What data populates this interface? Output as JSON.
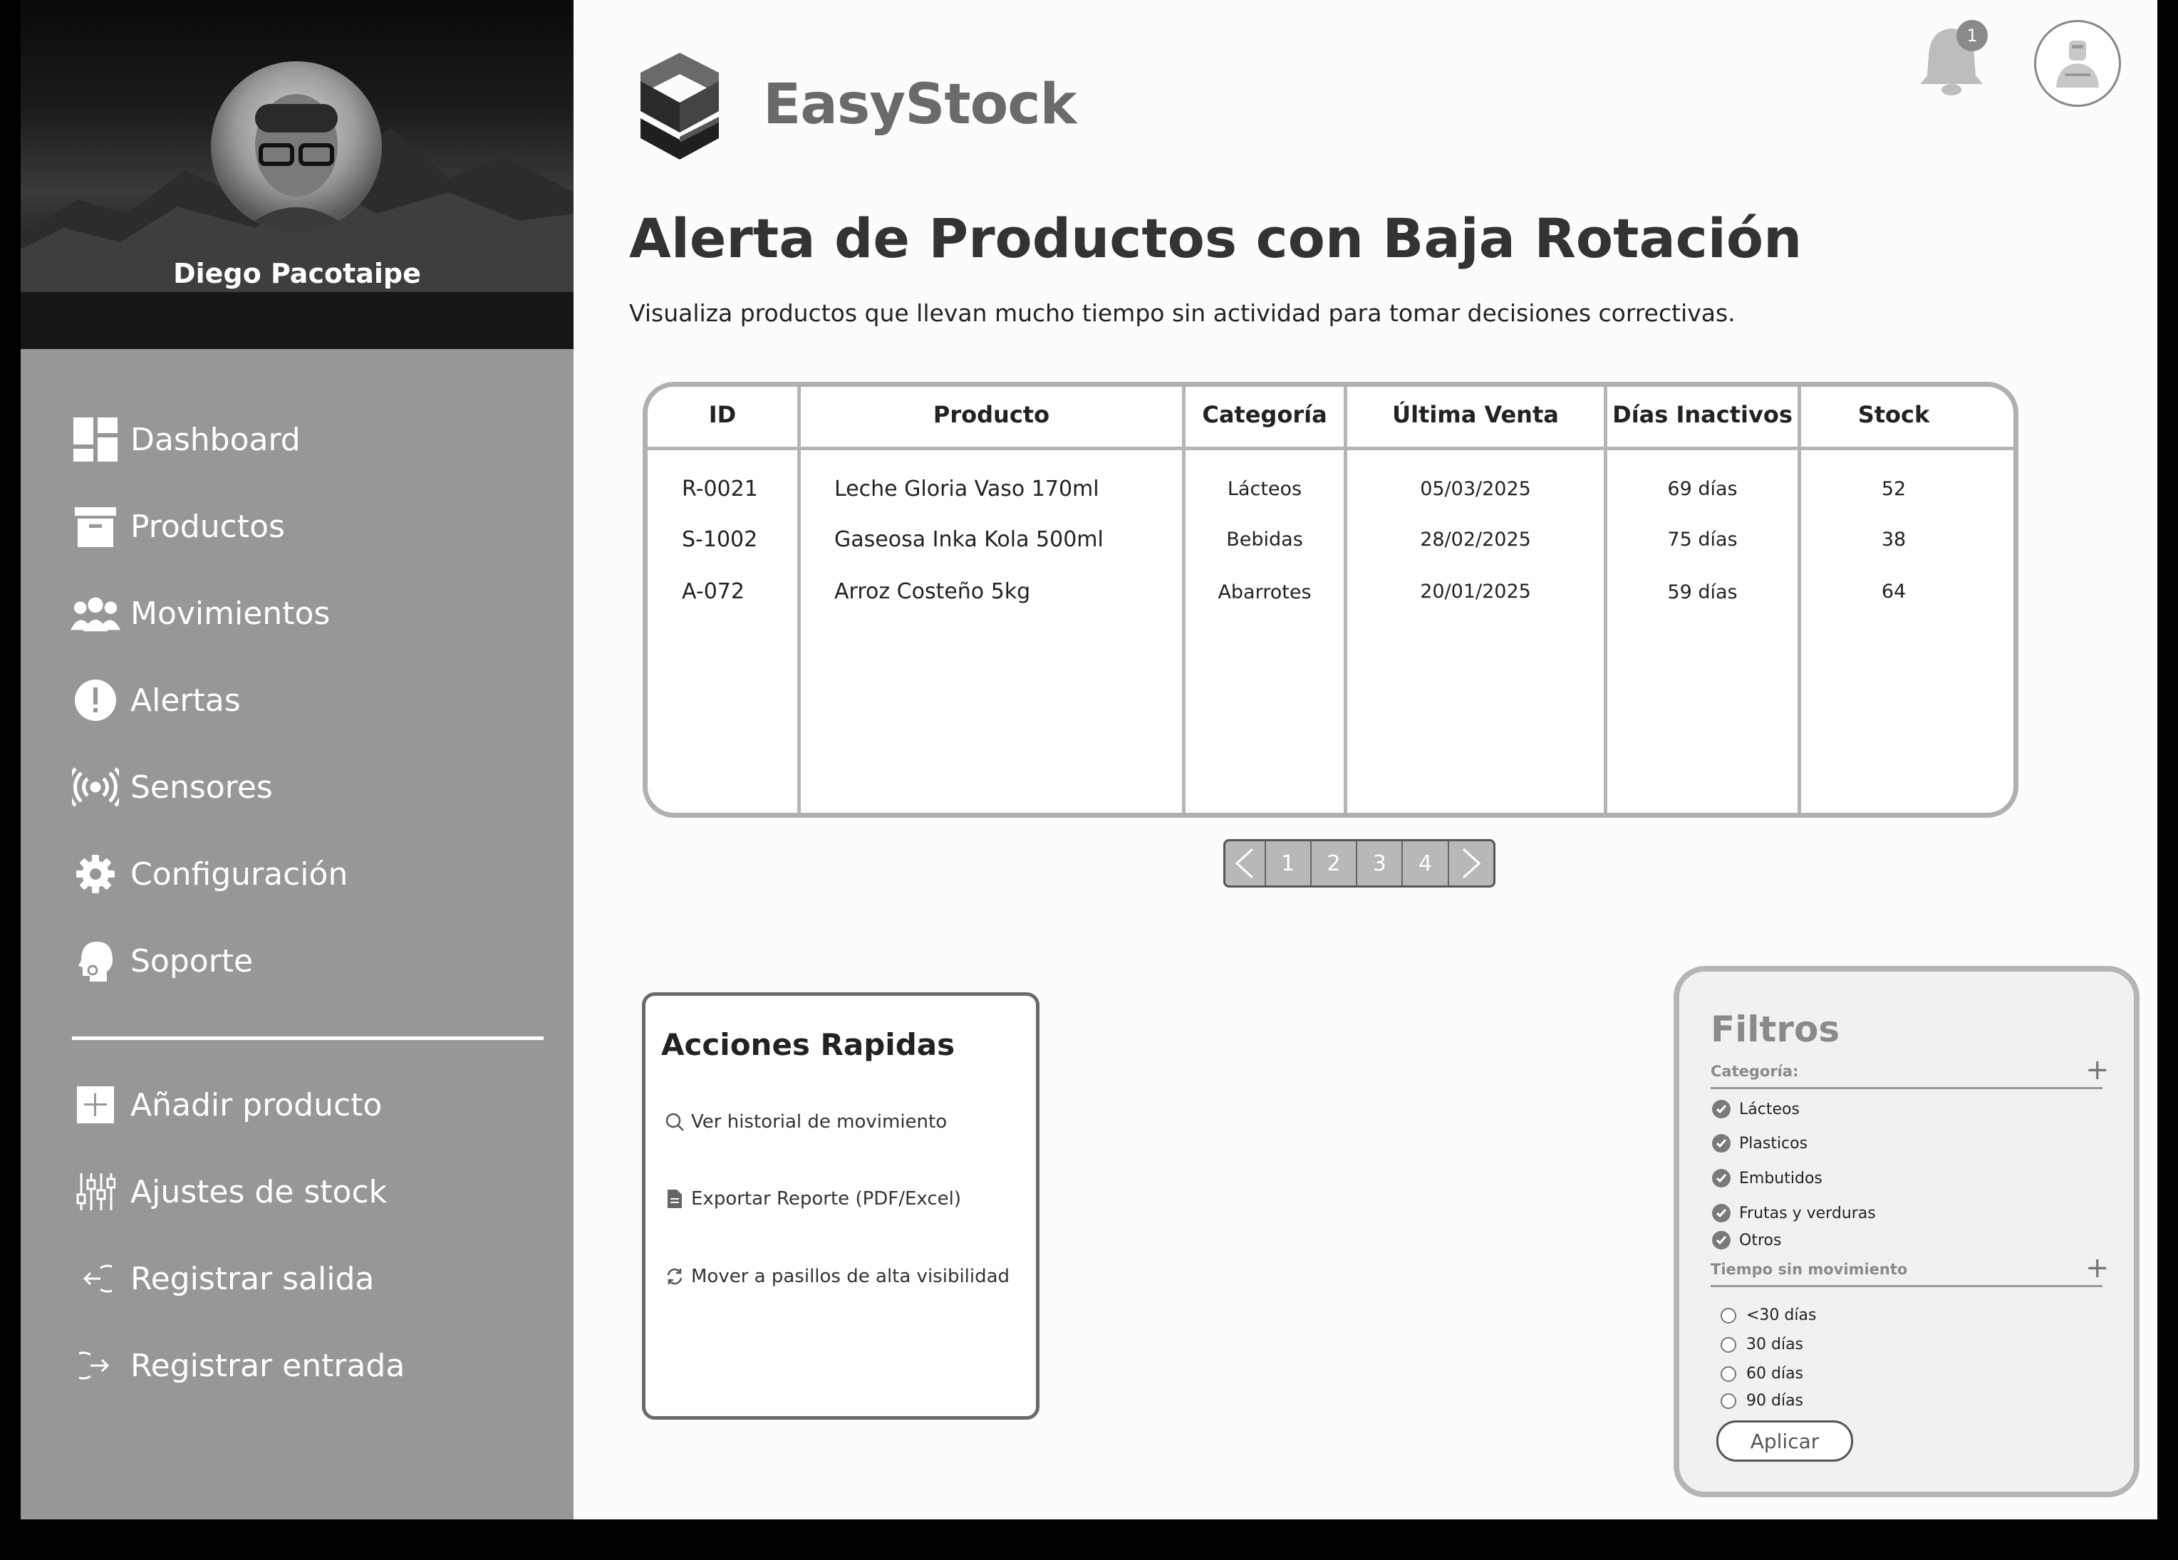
{
  "profile": {
    "name": "Diego Pacotaipe"
  },
  "nav": {
    "main": [
      {
        "label": "Dashboard",
        "icon": "dashboard-icon"
      },
      {
        "label": "Productos",
        "icon": "archive-box-icon"
      },
      {
        "label": "Movimientos",
        "icon": "users-icon"
      },
      {
        "label": "Alertas",
        "icon": "exclamation-icon"
      },
      {
        "label": "Sensores",
        "icon": "broadcast-icon"
      },
      {
        "label": "Configuración",
        "icon": "gear-icon"
      },
      {
        "label": "Soporte",
        "icon": "support-agent-icon"
      }
    ],
    "secondary": [
      {
        "label": "Añadir producto",
        "icon": "plus-square-icon"
      },
      {
        "label": "Ajustes de stock",
        "icon": "sliders-icon"
      },
      {
        "label": "Registrar salida",
        "icon": "sign-out-icon"
      },
      {
        "label": "Registrar entrada",
        "icon": "sign-in-icon"
      }
    ]
  },
  "header": {
    "brand": "EasyStock",
    "notifications_count": "1"
  },
  "page": {
    "title": "Alerta de Productos con Baja Rotación",
    "subtitle": "Visualiza productos que llevan mucho tiempo sin actividad para tomar decisiones correctivas."
  },
  "table": {
    "columns": [
      "ID",
      "Producto",
      "Categoría",
      "Última Venta",
      "Días Inactivos",
      "Stock"
    ],
    "rows": [
      [
        "R-0021",
        "Leche Gloria Vaso 170ml",
        "Lácteos",
        "05/03/2025",
        "69 días",
        "52"
      ],
      [
        "S-1002",
        "Gaseosa Inka Kola 500ml",
        "Bebidas",
        "28/02/2025",
        "75 días",
        "38"
      ],
      [
        "A-072",
        "Arroz Costeño 5kg",
        "Abarrotes",
        "20/01/2025",
        "59 días",
        "64"
      ]
    ]
  },
  "pagination": {
    "pages": [
      "1",
      "2",
      "3",
      "4"
    ]
  },
  "quick_actions": {
    "title": "Acciones Rapidas",
    "items": [
      {
        "label": "Ver historial de movimiento",
        "icon": "search-icon"
      },
      {
        "label": "Exportar Reporte (PDF/Excel)",
        "icon": "document-icon"
      },
      {
        "label": "Mover a pasillos de alta visibilidad",
        "icon": "refresh-icon"
      }
    ]
  },
  "filters": {
    "title": "Filtros",
    "category_label": "Categoría:",
    "categories": [
      "Lácteos",
      "Plasticos",
      "Embutidos",
      "Frutas y verduras",
      "Otros"
    ],
    "time_label": "Tiempo sin movimiento",
    "time_options": [
      "<30 días",
      "30 días",
      "60 días",
      "90 días"
    ],
    "apply_label": "Aplicar"
  },
  "colors": {
    "sidebar": "#979797",
    "accent_gray": "#b5b5b5",
    "text_dark": "#222222"
  }
}
